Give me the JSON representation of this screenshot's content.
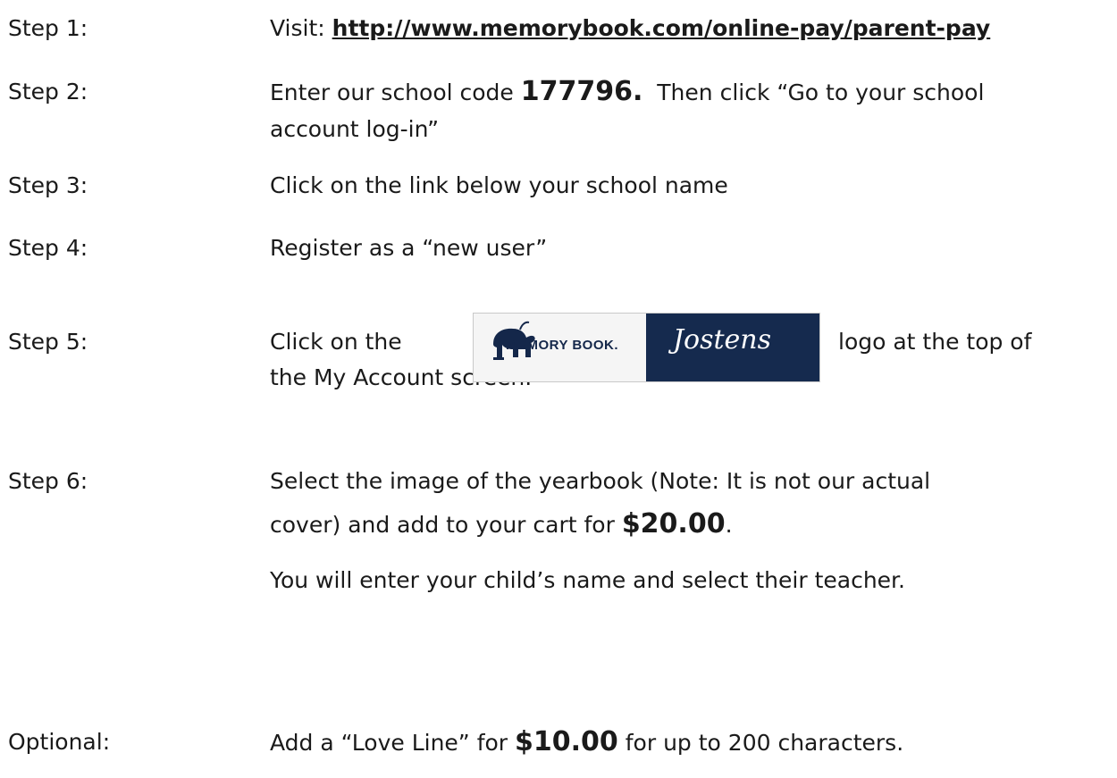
{
  "steps": [
    {
      "label": "Step 1:",
      "prefix": "Visit: ",
      "link": "http://www.memorybook.com/online-pay/parent-pay"
    },
    {
      "label": "Step 2:",
      "line1_a": "Enter our school code ",
      "code": "177796.",
      "line1_b": "  Then click “Go to your school",
      "line2": "account log-in”"
    },
    {
      "label": "Step 3:",
      "text": "Click on the link below your school name"
    },
    {
      "label": "Step 4:",
      "text": "Register as a “new user”"
    },
    {
      "label": "Step 5:",
      "before": "Click on the",
      "after": "logo at the top of",
      "line2": "the My Account screen."
    },
    {
      "label": " Step 6:",
      "line1": "Select the image of the yearbook (Note: It is not our actual",
      "line2_a": "cover) and add to your cart for ",
      "price": "$20.00",
      "line2_b": ".",
      "line3": "You will enter your child’s name and select their teacher."
    }
  ],
  "optional": {
    "label": "Optional:",
    "a": "Add a “Love Line” for ",
    "price": "$10.00",
    "b": " for up to 200 characters."
  },
  "logo": {
    "left_text": "MEMORY BOOK.",
    "right_text": "Jostens"
  }
}
